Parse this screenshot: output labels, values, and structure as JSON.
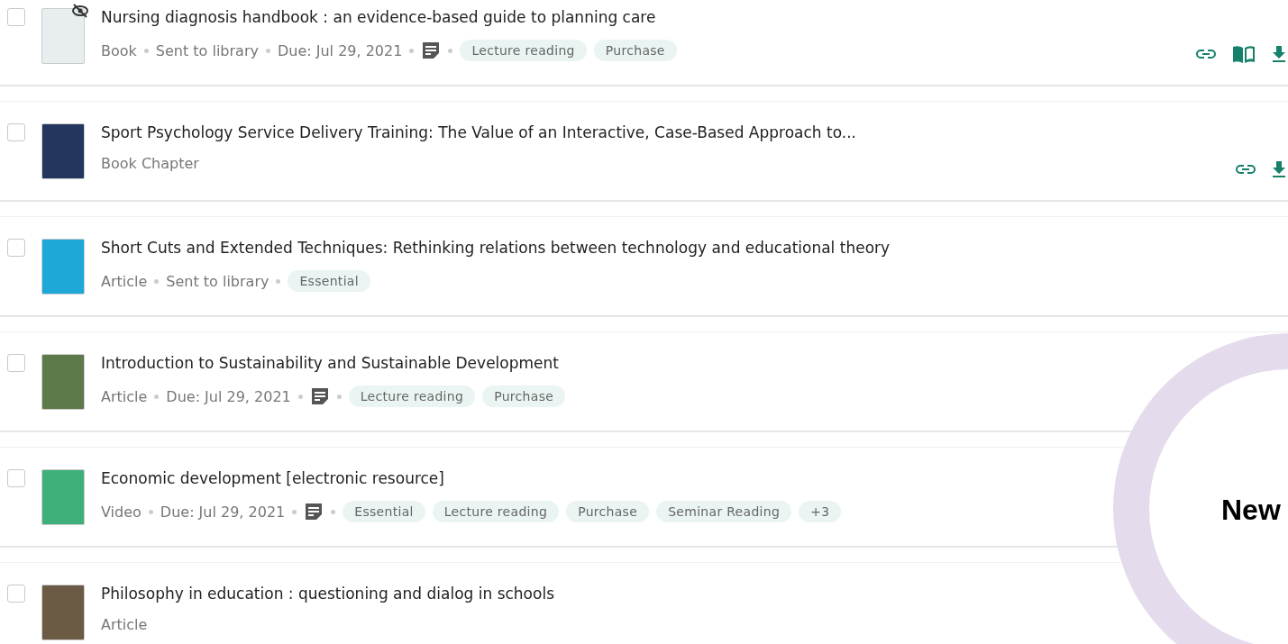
{
  "items": [
    {
      "title": "Nursing diagnosis handbook : an evidence-based guide to planning care",
      "checked": false,
      "hidden": true,
      "color": "#e8eef0",
      "meta": [
        {
          "kind": "text",
          "text": "Book"
        },
        {
          "kind": "text",
          "text": "Sent to library"
        },
        {
          "kind": "text",
          "text": "Due: Jul 29, 2021"
        },
        {
          "kind": "note"
        }
      ],
      "tags": [
        "Lecture reading",
        "Purchase"
      ],
      "actions": [
        {
          "kind": "link"
        },
        {
          "kind": "read"
        },
        {
          "kind": "download"
        }
      ]
    },
    {
      "title": "Sport Psychology Service Delivery Training: The Value of an Interactive, Case-Based Approach to...",
      "checked": false,
      "hidden": false,
      "color": "#23365e",
      "meta": [
        {
          "kind": "text",
          "text": "Book Chapter"
        }
      ],
      "actions": [
        {
          "kind": "link"
        },
        {
          "kind": "download"
        }
      ]
    },
    {
      "title": "Short Cuts and Extended Techniques: Rethinking relations between technology and educational theory",
      "checked": false,
      "hidden": false,
      "color": "#1ea8d8",
      "meta": [
        {
          "kind": "text",
          "text": "Article"
        },
        {
          "kind": "text",
          "text": "Sent to library"
        }
      ],
      "tags": [
        "Essential"
      ]
    },
    {
      "title": "Introduction to Sustainability and Sustainable Development",
      "checked": false,
      "hidden": false,
      "color": "#5c7a4a",
      "meta": [
        {
          "kind": "text",
          "text": "Article"
        },
        {
          "kind": "text",
          "text": "Due: Jul 29, 2021"
        },
        {
          "kind": "note"
        }
      ],
      "tags": [
        "Lecture reading",
        "Purchase"
      ]
    },
    {
      "title": "Economic development [electronic resource]",
      "checked": false,
      "hidden": false,
      "color": "#3fb07a",
      "meta": [
        {
          "kind": "text",
          "text": "Video"
        },
        {
          "kind": "text",
          "text": "Due: Jul 29, 2021"
        },
        {
          "kind": "note"
        }
      ],
      "tags": [
        "Essential",
        "Lecture reading",
        "Purchase",
        "Seminar Reading",
        "+3"
      ]
    },
    {
      "title": "Philosophy in education : questioning and dialog in schools",
      "checked": false,
      "hidden": false,
      "color": "#6b5a44",
      "meta": [
        {
          "kind": "text",
          "text": "Article"
        }
      ]
    }
  ],
  "badge": {
    "text": "New"
  }
}
